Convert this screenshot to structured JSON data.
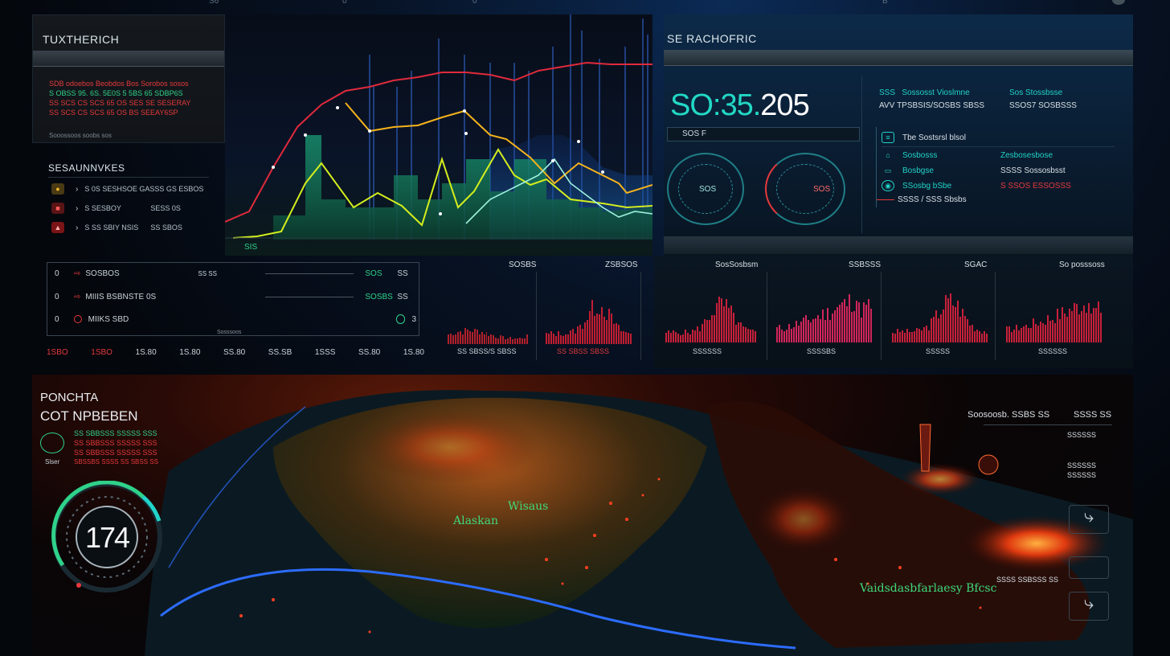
{
  "top_ticks": [
    "S6",
    "0",
    "0",
    "",
    "",
    "B",
    "",
    ""
  ],
  "left_panel": {
    "title": "TUXTHERICH",
    "lines": [
      {
        "text": "SDB odoebos Beobdos Bos  Sorobos sosos",
        "color": "#e6393b"
      },
      {
        "text": "S OBSS 95. 6S. 5E0S 5 5BS 65 SDBP6S",
        "color": "#2fd28a"
      },
      {
        "text": "SS SCS CS SCS 65 OS SES SE SESERAY",
        "color": "#e6393b"
      },
      {
        "text": "SS SCS CS SCS 65 OS BS SEEAY6SP",
        "color": "#e6393b"
      }
    ],
    "footer": "Sooossoos soobs sos"
  },
  "stats_panel": {
    "title": "SESAUNNVKES",
    "rows": [
      {
        "arrow": "›",
        "label": "S 0S SESHSOE GASSS GS ESBOS",
        "value": ""
      },
      {
        "arrow": "›",
        "label": "S SESBOY",
        "value": "SESS 0S"
      },
      {
        "arrow": "›",
        "label": "S SS SBIY NSIS",
        "value": "SS SBOS"
      }
    ]
  },
  "main_chart": {
    "x_label": "SIS"
  },
  "list_panel": {
    "rows": [
      {
        "num": "0",
        "label": "SOSBOS",
        "mid": "SS SS",
        "val1": "SOS",
        "val2": "SS"
      },
      {
        "num": "0",
        "label": "MIIIS BSBNSTE 0S",
        "mid": "",
        "val1": "SOSBS",
        "val2": "SS"
      },
      {
        "num": "0",
        "label": "MIIKS SBD",
        "mid": "",
        "val1": "",
        "val2": "3"
      }
    ],
    "footnote": "Sosssoos",
    "ticks": [
      "1SBO",
      "1SBO",
      "1S.80",
      "1S.80",
      "SS.80",
      "SS.SB",
      "1SSS",
      "SS.80",
      "SS.80",
      "1S.80"
    ]
  },
  "mini_charts_left": [
    {
      "title": "SOSBS",
      "footer": "SS SBSS/S SBSS"
    },
    {
      "title": "ZSBSOS",
      "footer": "SS SBSS SBSS"
    }
  ],
  "right_panel": {
    "title": "SE RACHOFRIC",
    "big_number_left": "SO:35.",
    "big_number_right": "205",
    "sub_label": "SOS F",
    "gauge1_label": "SOS",
    "gauge2_label": "SOS",
    "info": [
      {
        "a": "SSS",
        "b": "Sossosst Vioslmne"
      },
      {
        "a": "AVV",
        "b": "TPSBSIS/SOSBS SBSS"
      },
      {
        "a": "Sos Stossbsse",
        "b": "SSOS7 SOSBSSS"
      }
    ],
    "table": [
      {
        "label": "Tbe Sostsrsl blsol",
        "value": ""
      },
      {
        "label": "Sosbosss",
        "value": "Zesbosesbose"
      },
      {
        "label": "Bosbgse",
        "value": "SSSS Sossosbsst"
      },
      {
        "label": "SSosbg bSbe",
        "value": "S SSOS ESSOSSS"
      },
      {
        "label": "SSSS / SSS Sbsbs",
        "value": ""
      }
    ]
  },
  "mini_charts_right": [
    {
      "title": "SosSosbsm",
      "footer": "SSSSSS"
    },
    {
      "title": "SSBSSS",
      "footer": "SSSSBS"
    },
    {
      "title": "SGAC",
      "footer": "SSSSS"
    },
    {
      "title": "So posssoss",
      "footer": "SSSSSS"
    }
  ],
  "map_panel": {
    "title_line1": "PONCHTA",
    "title_line2": "COT NPBEBEN",
    "legend": [
      {
        "text": "SS SBBSSS SSSSS SSS",
        "color": "#2fd28a"
      },
      {
        "text": "SS SBBSSS SSSSS SSS",
        "color": "#e6393b"
      },
      {
        "text": "SBSSBS SSSS SS SBSS SS",
        "color": "#e6393b"
      }
    ],
    "legend_side": "Slser",
    "gauge_value": "174",
    "labels": [
      {
        "text": "Alaskan",
        "color": "#3fd97a"
      },
      {
        "text": "Wisaus",
        "color": "#3fd97a"
      },
      {
        "text": "Vaidsdasbfarlaesy Bfcsc",
        "color": "#3fd97a"
      }
    ],
    "right_top": [
      "Soosoosb. SSBS SS",
      "SSSS SS"
    ],
    "right_rows": [
      "SSSSSS",
      "SSSSSS",
      "SSSSSS",
      "SSSSSS",
      "SSSS SSBSSS SS"
    ]
  }
}
